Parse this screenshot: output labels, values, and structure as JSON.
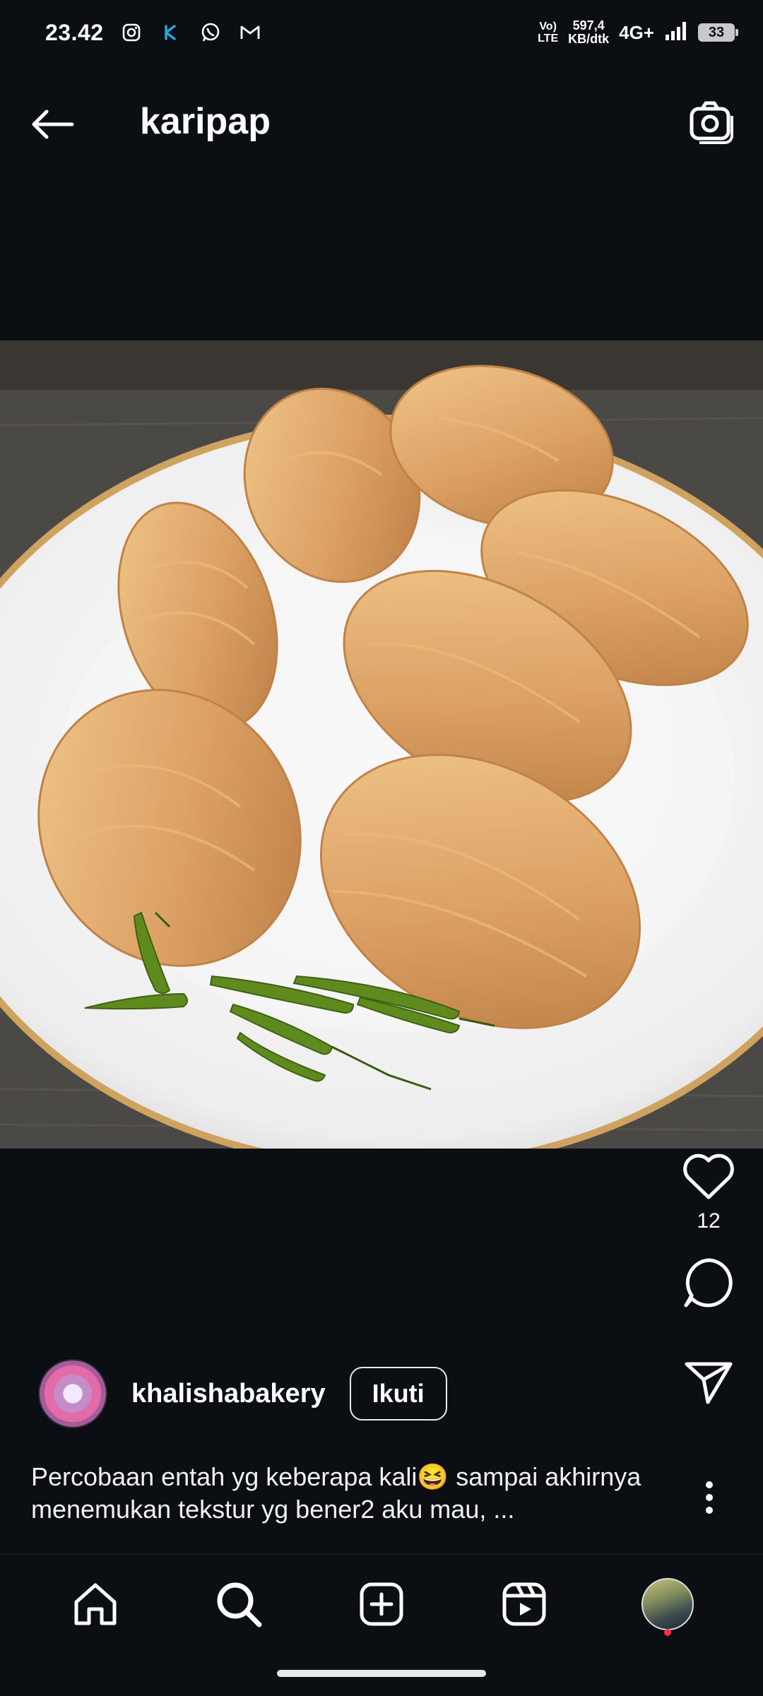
{
  "status_bar": {
    "time": "23.42",
    "volte_top": "Vo)",
    "volte_bottom": "LTE",
    "speed_top": "597,4",
    "speed_bottom": "KB/dtk",
    "network": "4G+",
    "battery": "33",
    "notification_icons": [
      "instagram-icon",
      "app-icon",
      "whatsapp-icon",
      "gmail-icon"
    ]
  },
  "header": {
    "title": "karipap"
  },
  "post": {
    "image_alt_icon": "karipap-photo",
    "like_count": "12",
    "author": "khalishabakery",
    "follow_label": "Ikuti",
    "caption": "Percobaan entah yg keberapa kali😆 sampai akhirnya menemukan tekstur yg bener2 aku mau, ..."
  },
  "bottom_nav": {
    "items": [
      "home-icon",
      "search-icon",
      "create-icon",
      "reels-icon",
      "profile-avatar"
    ]
  },
  "colors": {
    "background": "#0b0f14",
    "text": "#ffffff",
    "notification_dot": "#ff3040"
  }
}
